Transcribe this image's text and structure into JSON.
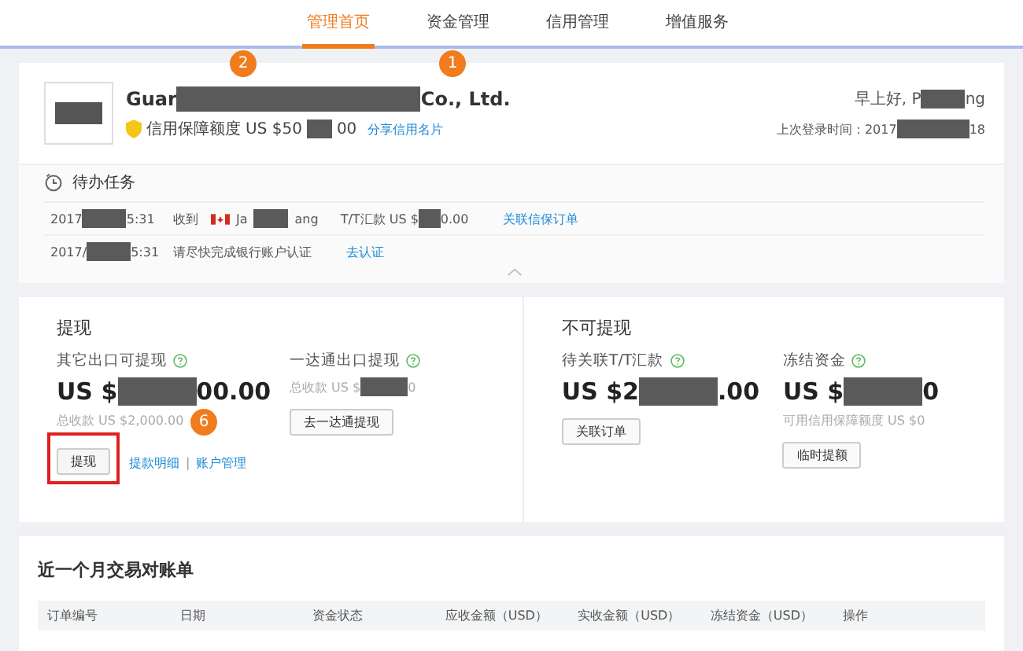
{
  "nav": {
    "tabs": [
      {
        "label": "管理首页",
        "selected": true
      },
      {
        "label": "资金管理",
        "selected": false
      },
      {
        "label": "信用管理",
        "selected": false
      },
      {
        "label": "增值服务",
        "selected": false
      }
    ]
  },
  "profile": {
    "company": [
      "Guar",
      "Co., Ltd."
    ],
    "credit_label": "信用保障额度",
    "credit_amount": [
      "US $50",
      "00"
    ],
    "share_link": "分享信用名片",
    "greeting": [
      "早上好, P",
      "ng"
    ],
    "last_login": [
      "上次登录时间：2017",
      "18"
    ]
  },
  "tasks": {
    "title": "待办任务",
    "rows": [
      {
        "date": [
          "2017",
          "5:31"
        ],
        "text": [
          "收到"
        ],
        "flag": true,
        "name": [
          "Ja",
          "ang"
        ],
        "amount": [
          "T/T汇款 US $",
          "0.00"
        ],
        "link": "关联信保订单"
      },
      {
        "date": [
          "2017/",
          "5:31"
        ],
        "text": [
          "请尽快完成银行账户认证"
        ],
        "link": "去认证"
      }
    ]
  },
  "withdraw": {
    "panels": [
      {
        "title": "提现",
        "items": [
          {
            "label": "其它出口可提现",
            "amount": [
              "US $",
              "00.00"
            ],
            "sub": [
              "总收款  US $2,000.00"
            ],
            "actions": [
              {
                "kind": "button",
                "label": "提现",
                "highlighted": true
              },
              {
                "kind": "link",
                "label": "提款明细"
              },
              {
                "kind": "separator",
                "label": "|"
              },
              {
                "kind": "link",
                "label": "账户管理"
              }
            ]
          },
          {
            "label": "一达通出口提现",
            "sub": [
              "总收款  US $",
              "0"
            ],
            "actions": [
              {
                "kind": "button",
                "label": "去一达通提现",
                "highlighted": false
              }
            ]
          }
        ]
      },
      {
        "title": "不可提现",
        "items": [
          {
            "label": "待关联T/T汇款",
            "amount": [
              "US $2",
              ".00"
            ],
            "actions": [
              {
                "kind": "button",
                "label": "关联订单",
                "highlighted": false
              }
            ]
          },
          {
            "label": "冻结资金",
            "amount": [
              "US $",
              "0"
            ],
            "sub": [
              "可用信用保障额度  US $0"
            ],
            "actions": [
              {
                "kind": "button",
                "label": "临时提额",
                "highlighted": false
              }
            ]
          }
        ]
      }
    ]
  },
  "statement": {
    "title": "近一个月交易对账单",
    "columns": [
      "订单编号",
      "日期",
      "资金状态",
      "应收金额（USD）",
      "实收金额（USD）",
      "冻结资金（USD）",
      "操作"
    ]
  },
  "annotations": [
    {
      "label": "2"
    },
    {
      "label": "1"
    },
    {
      "label": "6"
    }
  ]
}
